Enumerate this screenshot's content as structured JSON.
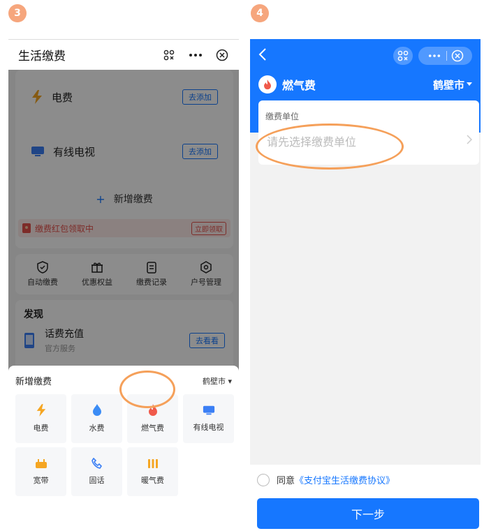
{
  "steps": {
    "left": "3",
    "right": "4"
  },
  "left": {
    "nav": {
      "title": "生活缴费"
    },
    "bills": [
      {
        "label": "电费",
        "button": "去添加"
      },
      {
        "label": "有线电视",
        "button": "去添加"
      }
    ],
    "add_label": "新增缴费",
    "promo": {
      "text": "缴费红包领取中",
      "button": "立即领取"
    },
    "tools": [
      "自动缴费",
      "优惠权益",
      "缴费记录",
      "户号管理"
    ],
    "discover": {
      "title": "发现",
      "item": {
        "title": "话费充值",
        "subtitle": "官方服务",
        "button": "去看看"
      }
    },
    "sheet": {
      "title": "新增缴费",
      "city": "鹤壁市 ▾",
      "items": [
        "电费",
        "水费",
        "燃气费",
        "有线电视",
        "宽带",
        "固话",
        "暖气费"
      ]
    }
  },
  "right": {
    "header": {
      "name": "燃气费",
      "city": "鹤壁市"
    },
    "unit": {
      "label": "缴费单位",
      "placeholder": "请先选择缴费单位"
    },
    "agree": {
      "prefix": "同意",
      "link": "《支付宝生活缴费协议》"
    },
    "next": "下一步"
  },
  "colors": {
    "brand": "#1677ff",
    "badge": "#f6a67d",
    "highlight_ring": "#f5a05a",
    "promo": "#e4504b"
  }
}
